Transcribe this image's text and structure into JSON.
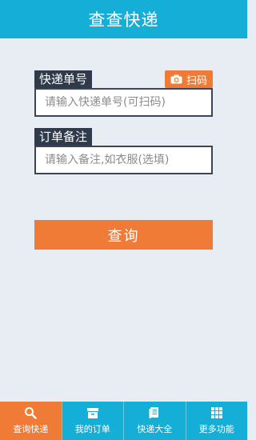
{
  "header": {
    "title": "查查快递"
  },
  "tracking": {
    "label": "快递单号",
    "placeholder": "请输入快递单号(可扫码)",
    "scan_label": "扫码",
    "scan_icon": "camera-icon"
  },
  "note": {
    "label": "订单备注",
    "placeholder": "请输入备注,如衣服(选填)"
  },
  "query_button": "查询",
  "tabbar": {
    "items": [
      {
        "label": "查询快递",
        "icon": "search-icon",
        "active": true
      },
      {
        "label": "我的订单",
        "icon": "archive-box-icon",
        "active": false
      },
      {
        "label": "快递大全",
        "icon": "book-icon",
        "active": false
      },
      {
        "label": "更多功能",
        "icon": "grid-icon",
        "active": false
      }
    ]
  },
  "colors": {
    "primary": "#14aed6",
    "accent": "#f07b36",
    "label_bg": "#2f3a4b",
    "background": "#e8ecf3"
  }
}
